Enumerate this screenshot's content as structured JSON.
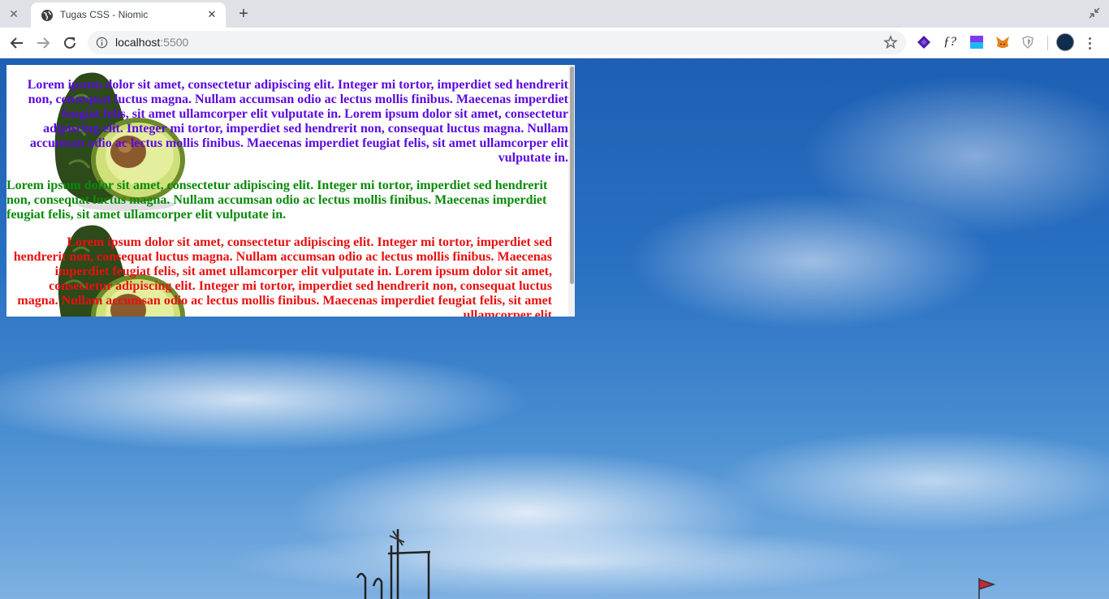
{
  "browser": {
    "tab_title": "Tugas CSS - Niomic",
    "url_host": "localhost",
    "url_port": ":5500"
  },
  "content": {
    "paragraph1": "Lorem ipsum dolor sit amet, consectetur adipiscing elit. Integer mi tortor, imperdiet sed hendrerit non, consequat luctus magna. Nullam accumsan odio ac lectus mollis finibus. Maecenas imperdiet feugiat felis, sit amet ullamcorper elit vulputate in. Lorem ipsum dolor sit amet, consectetur adipiscing elit. Integer mi tortor, imperdiet sed hendrerit non, consequat luctus magna. Nullam accumsan odio ac lectus mollis finibus. Maecenas imperdiet feugiat felis, sit amet ullamcorper elit vulputate in.",
    "paragraph2": "Lorem ipsum dolor sit amet, consectetur adipiscing elit. Integer mi tortor, imperdiet sed hendrerit non, consequat luctus magna. Nullam accumsan odio ac lectus mollis finibus. Maecenas imperdiet feugiat felis, sit amet ullamcorper elit vulputate in.",
    "paragraph3": "Lorem ipsum dolor sit amet, consectetur adipiscing elit. Integer mi tortor, imperdiet sed hendrerit non, consequat luctus magna. Nullam accumsan odio ac lectus mollis finibus. Maecenas imperdiet feugiat felis, sit amet ullamcorper elit vulputate in. Lorem ipsum dolor sit amet, consectetur adipiscing elit. Integer mi tortor, imperdiet sed hendrerit non, consequat luctus magna. Nullam accumsan odio ac lectus mollis finibus. Maecenas imperdiet feugiat felis, sit amet ullamcorper elit",
    "colors": {
      "paragraph1": "#5b0be0",
      "paragraph2": "#0a8a0a",
      "paragraph3": "#e81010"
    }
  },
  "icons": {
    "extensions": [
      "stack-icon",
      "font-ninja-icon",
      "gradient-square-icon",
      "metamask-fox-icon",
      "shield-icon"
    ]
  }
}
